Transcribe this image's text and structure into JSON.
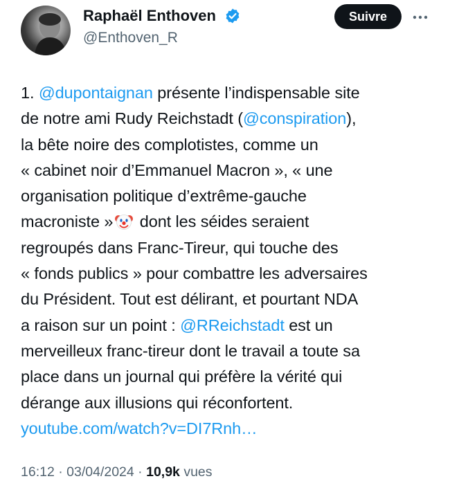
{
  "author": {
    "name": "Raphaël Enthoven",
    "handle": "@Enthoven_R",
    "verified": true,
    "avatar_icon": "profile-photo",
    "verified_icon": "verified-badge-icon",
    "verified_color": "#1d9bf0"
  },
  "actions": {
    "follow_label": "Suivre",
    "more_icon": "more-dots-icon"
  },
  "tweet": {
    "lines": [
      [
        {
          "t": "1. "
        },
        {
          "t": "@dupontaignan",
          "k": "mention"
        },
        {
          "t": " présente l’indispensable site"
        }
      ],
      [
        {
          "t": "de notre ami Rudy Reichstadt ("
        },
        {
          "t": "@conspiration",
          "k": "mention"
        },
        {
          "t": "),"
        }
      ],
      [
        {
          "t": "la bête noire des complotistes, comme un"
        }
      ],
      [
        {
          "t": "« cabinet noir d’Emmanuel Macron », « une"
        }
      ],
      [
        {
          "t": "organisation politique d’extrême-gauche"
        }
      ],
      [
        {
          "t": "macroniste »"
        },
        {
          "k": "emoji",
          "icon": "clown-face-emoji"
        },
        {
          "t": " dont les séides seraient"
        }
      ],
      [
        {
          "t": "regroupés dans Franc-Tireur, qui touche des"
        }
      ],
      [
        {
          "t": "« fonds publics » pour combattre les adversaires"
        }
      ],
      [
        {
          "t": "du Président. Tout est délirant, et pourtant NDA"
        }
      ],
      [
        {
          "t": "a raison sur un point : "
        },
        {
          "t": "@RReichstadt",
          "k": "mention"
        },
        {
          "t": "  est un"
        }
      ],
      [
        {
          "t": "merveilleux franc-tireur dont le travail a toute sa"
        }
      ],
      [
        {
          "t": "place dans un journal qui préfère la vérité qui"
        }
      ],
      [
        {
          "t": "dérange aux illusions qui réconfortent."
        }
      ],
      [
        {
          "t": "youtube.com/watch?v=DI7Rnh…",
          "k": "link"
        }
      ]
    ]
  },
  "meta": {
    "time": "16:12",
    "separator": " · ",
    "date": "03/04/2024",
    "views_count": "10,9k",
    "views_label": " vues"
  },
  "colors": {
    "text": "#0f1419",
    "secondary": "#536471",
    "accent": "#1d9bf0",
    "button_bg": "#0f1419"
  }
}
